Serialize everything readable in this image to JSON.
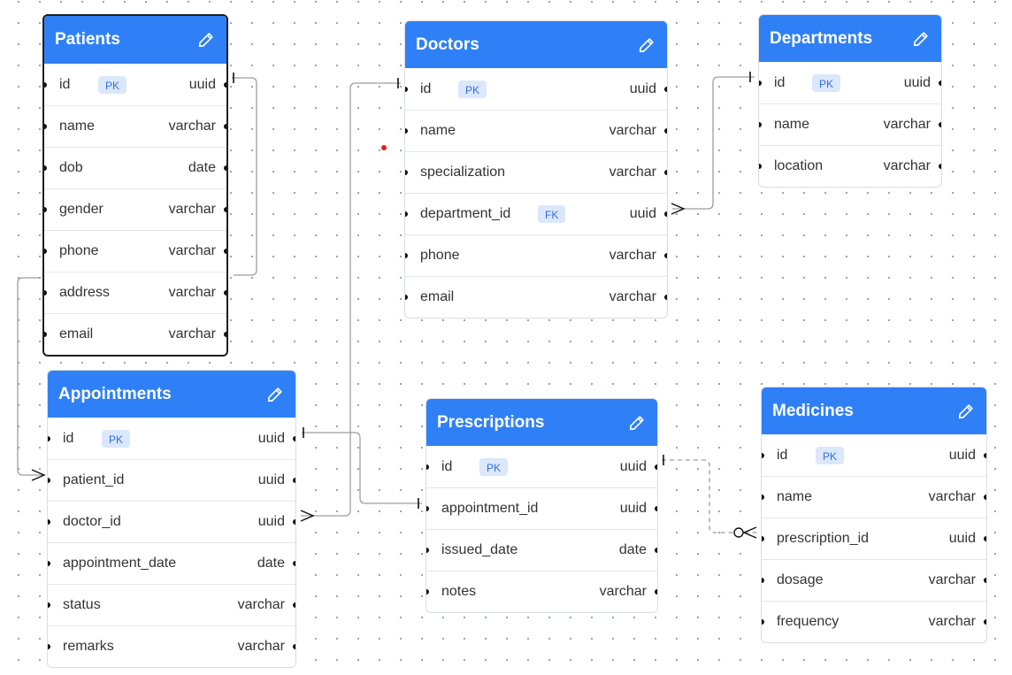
{
  "diagram": {
    "tables": [
      {
        "id": "patients",
        "name": "Patients",
        "selected": true,
        "fields": [
          {
            "name": "id",
            "badge": "PK",
            "type": "uuid"
          },
          {
            "name": "name",
            "badge": "",
            "type": "varchar"
          },
          {
            "name": "dob",
            "badge": "",
            "type": "date"
          },
          {
            "name": "gender",
            "badge": "",
            "type": "varchar"
          },
          {
            "name": "phone",
            "badge": "",
            "type": "varchar"
          },
          {
            "name": "address",
            "badge": "",
            "type": "varchar"
          },
          {
            "name": "email",
            "badge": "",
            "type": "varchar"
          }
        ]
      },
      {
        "id": "doctors",
        "name": "Doctors",
        "selected": false,
        "fields": [
          {
            "name": "id",
            "badge": "PK",
            "type": "uuid"
          },
          {
            "name": "name",
            "badge": "",
            "type": "varchar"
          },
          {
            "name": "specialization",
            "badge": "",
            "type": "varchar"
          },
          {
            "name": "department_id",
            "badge": "FK",
            "type": "uuid"
          },
          {
            "name": "phone",
            "badge": "",
            "type": "varchar"
          },
          {
            "name": "email",
            "badge": "",
            "type": "varchar"
          }
        ]
      },
      {
        "id": "departments",
        "name": "Departments",
        "selected": false,
        "fields": [
          {
            "name": "id",
            "badge": "PK",
            "type": "uuid"
          },
          {
            "name": "name",
            "badge": "",
            "type": "varchar"
          },
          {
            "name": "location",
            "badge": "",
            "type": "varchar"
          }
        ]
      },
      {
        "id": "appointments",
        "name": "Appointments",
        "selected": false,
        "fields": [
          {
            "name": "id",
            "badge": "PK",
            "type": "uuid"
          },
          {
            "name": "patient_id",
            "badge": "",
            "type": "uuid"
          },
          {
            "name": "doctor_id",
            "badge": "",
            "type": "uuid"
          },
          {
            "name": "appointment_date",
            "badge": "",
            "type": "date"
          },
          {
            "name": "status",
            "badge": "",
            "type": "varchar"
          },
          {
            "name": "remarks",
            "badge": "",
            "type": "varchar"
          }
        ]
      },
      {
        "id": "prescriptions",
        "name": "Prescriptions",
        "selected": false,
        "fields": [
          {
            "name": "id",
            "badge": "PK",
            "type": "uuid"
          },
          {
            "name": "appointment_id",
            "badge": "",
            "type": "uuid"
          },
          {
            "name": "issued_date",
            "badge": "",
            "type": "date"
          },
          {
            "name": "notes",
            "badge": "",
            "type": "varchar"
          }
        ]
      },
      {
        "id": "medicines",
        "name": "Medicines",
        "selected": false,
        "fields": [
          {
            "name": "id",
            "badge": "PK",
            "type": "uuid"
          },
          {
            "name": "name",
            "badge": "",
            "type": "varchar"
          },
          {
            "name": "prescription_id",
            "badge": "",
            "type": "uuid"
          },
          {
            "name": "dosage",
            "badge": "",
            "type": "varchar"
          },
          {
            "name": "frequency",
            "badge": "",
            "type": "varchar"
          }
        ]
      }
    ],
    "relationships": [
      {
        "from": "appointments.patient_id",
        "to": "patients.id",
        "from_cardinality": "many",
        "to_cardinality": "one",
        "style": "solid"
      },
      {
        "from": "appointments.doctor_id",
        "to": "doctors.id",
        "from_cardinality": "many",
        "to_cardinality": "one",
        "style": "solid"
      },
      {
        "from": "doctors.department_id",
        "to": "departments.id",
        "from_cardinality": "many",
        "to_cardinality": "one",
        "style": "solid"
      },
      {
        "from": "prescriptions.appointment_id",
        "to": "appointments.id",
        "from_cardinality": "one",
        "to_cardinality": "one",
        "style": "solid"
      },
      {
        "from": "medicines.prescription_id",
        "to": "prescriptions.id",
        "from_cardinality": "zero-or-many",
        "to_cardinality": "one",
        "style": "dashed"
      }
    ],
    "colors": {
      "header": "#2f80f7",
      "badge_bg": "#dbe7fb",
      "badge_text": "#2f6fe0",
      "link": "#9e9e9e",
      "marker": "#111111"
    }
  }
}
